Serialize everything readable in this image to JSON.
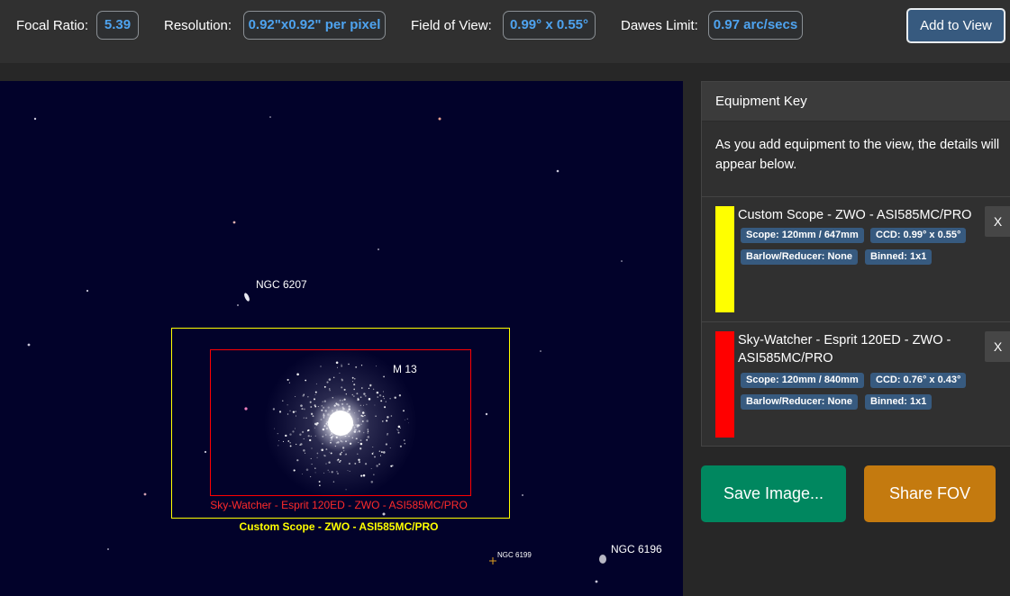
{
  "stats": {
    "focal_ratio_label": "Focal Ratio:",
    "focal_ratio_value": "5.39",
    "resolution_label": "Resolution:",
    "resolution_value": "0.92\"x0.92\" per pixel",
    "fov_label": "Field of View:",
    "fov_value": "0.99° x 0.55°",
    "dawes_label": "Dawes Limit:",
    "dawes_value": "0.97 arc/secs"
  },
  "add_to_view_label": "Add to View",
  "sky": {
    "objects": [
      "NGC 6207",
      "M 13",
      "NGC 6199",
      "NGC 6196"
    ],
    "fov_labels": [
      "Sky-Watcher - Esprit 120ED - ZWO - ASI585MC/PRO",
      "Custom Scope - ZWO - ASI585MC/PRO"
    ]
  },
  "equipment_key": {
    "title": "Equipment Key",
    "description": "As you add equipment to the view, the details will appear below.",
    "items": [
      {
        "name": "Custom Scope - ZWO - ASI585MC/PRO",
        "color": "#ffff00",
        "scope": "Scope: 120mm / 647mm",
        "ccd": "CCD: 0.99° x 0.55°",
        "barlow": "Barlow/Reducer: None",
        "binned": "Binned: 1x1",
        "remove": "X"
      },
      {
        "name": "Sky-Watcher - Esprit 120ED - ZWO - ASI585MC/PRO",
        "color": "#ff0000",
        "scope": "Scope: 120mm / 840mm",
        "ccd": "CCD: 0.76° x 0.43°",
        "barlow": "Barlow/Reducer: None",
        "binned": "Binned: 1x1",
        "remove": "X"
      }
    ]
  },
  "save_image_label": "Save Image...",
  "share_fov_label": "Share FOV",
  "colors": {
    "accent": "#375a7f",
    "stat_value": "#4ea3ef",
    "save": "#00875f",
    "share": "#c47a0f",
    "sky": "#02022a"
  }
}
